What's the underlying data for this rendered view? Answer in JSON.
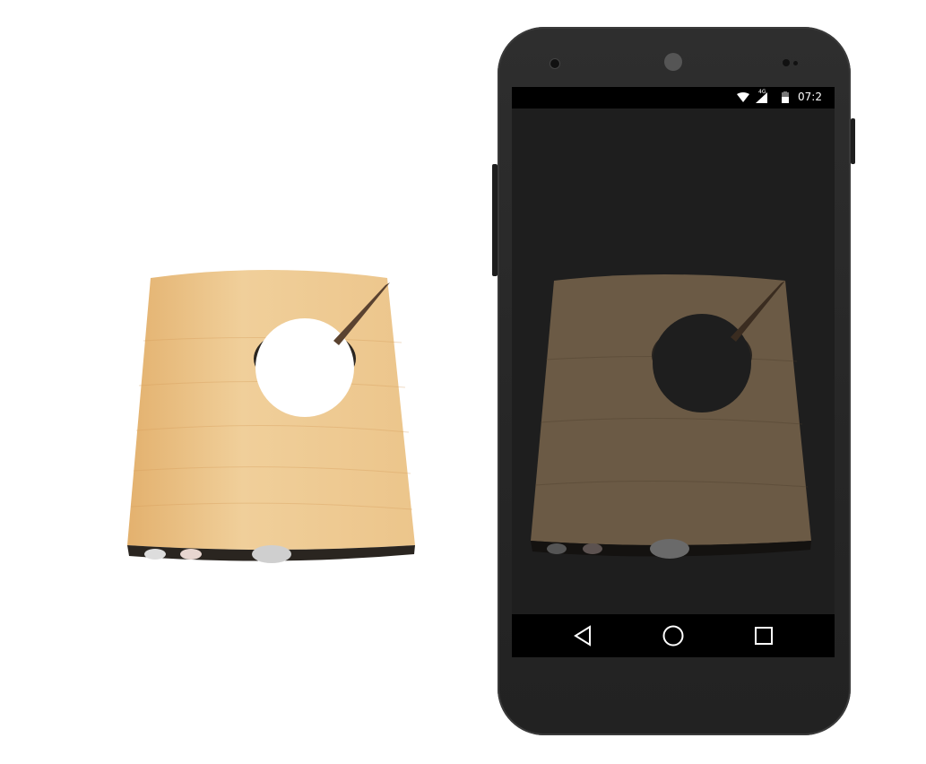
{
  "status_bar": {
    "network": "4G",
    "time": "07:2",
    "icons": [
      "wifi-icon",
      "cellular-signal-icon",
      "battery-icon"
    ]
  },
  "nav_bar": {
    "icons": [
      "back-icon",
      "home-icon",
      "recents-icon"
    ]
  },
  "colors": {
    "phone_body": "#2a2a2a",
    "screen_bg": "#1e1e1e",
    "wood": "#e9c38a"
  }
}
